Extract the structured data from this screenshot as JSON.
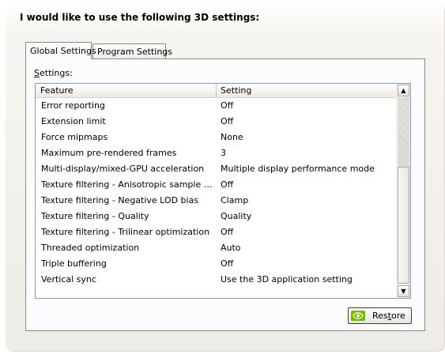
{
  "heading": "I would like to use the following 3D settings:",
  "tabs": [
    {
      "label": "Global Settings",
      "active": true
    },
    {
      "label": "Program Settings",
      "active": false
    }
  ],
  "settings_label": {
    "accel": "S",
    "rest": "ettings:"
  },
  "table": {
    "headers": {
      "feature": "Feature",
      "setting": "Setting"
    },
    "rows": [
      {
        "feature": "Error reporting",
        "setting": "Off"
      },
      {
        "feature": "Extension limit",
        "setting": "Off"
      },
      {
        "feature": "Force mipmaps",
        "setting": "None"
      },
      {
        "feature": "Maximum pre-rendered frames",
        "setting": "3"
      },
      {
        "feature": "Multi-display/mixed-GPU acceleration",
        "setting": "Multiple display performance mode"
      },
      {
        "feature": "Texture filtering - Anisotropic sample opti...",
        "setting": "Off"
      },
      {
        "feature": "Texture filtering - Negative LOD bias",
        "setting": "Clamp"
      },
      {
        "feature": "Texture filtering - Quality",
        "setting": "Quality"
      },
      {
        "feature": "Texture filtering - Trilinear optimization",
        "setting": "Off"
      },
      {
        "feature": "Threaded optimization",
        "setting": "Auto"
      },
      {
        "feature": "Triple buffering",
        "setting": "Off"
      },
      {
        "feature": "Vertical sync",
        "setting": "Use the 3D application setting"
      }
    ]
  },
  "scrollbar": {
    "up_icon": "up-arrow",
    "down_icon": "down-arrow"
  },
  "restore_button": {
    "label_pre": "Res",
    "label_accel": "t",
    "label_post": "ore",
    "icon": "nvidia-logo-icon"
  },
  "colors": {
    "accent": "#76b900",
    "list_border": "#7f9db9"
  }
}
